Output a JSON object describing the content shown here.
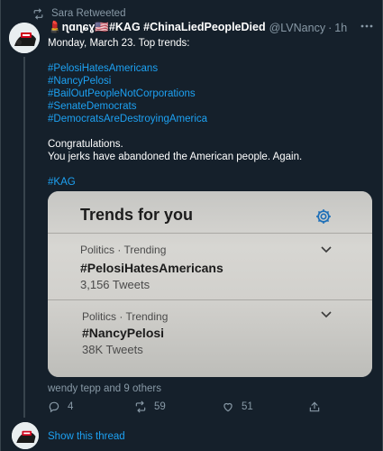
{
  "retweet_bar": {
    "label": "Sara Retweeted",
    "icon": "retweet-icon"
  },
  "tweet": {
    "author_name": "💄ɳɑɳɕɣ🇺🇸#KAG #ChinaLiedPeopleDied",
    "handle": "@LVNancy",
    "separator": "·",
    "time": "1h",
    "more_icon": "more-icon",
    "lines": {
      "intro": "Monday, March 23. Top trends:",
      "hashtags": [
        "#PelosiHatesAmericans",
        "#NancyPelosi",
        "#BailOutPeopleNotCorporations",
        "#SenateDemocrats",
        "#DemocratsAreDestroyingAmerica"
      ],
      "congrats": "Congratulations.",
      "message": "You jerks have abandoned the American people. Again.",
      "final_tag": "#KAG"
    },
    "photo": {
      "title": "Trends for you",
      "gear_icon": "gear-icon",
      "trends": [
        {
          "meta": "Politics · Trending",
          "name": "#PelosiHatesAmericans",
          "count": "3,156 Tweets"
        },
        {
          "meta": "Politics · Trending",
          "name": "#NancyPelosi",
          "count": "38K Tweets"
        }
      ]
    },
    "liked_by": "wendy tepp and 9 others",
    "actions": {
      "reply_count": "4",
      "retweet_count": "59",
      "like_count": "51"
    }
  },
  "show_thread": "Show this thread",
  "colors": {
    "background": "#15202b",
    "text": "#ffffff",
    "muted": "#8899a6",
    "link": "#1da1f2",
    "border": "#38444d"
  }
}
